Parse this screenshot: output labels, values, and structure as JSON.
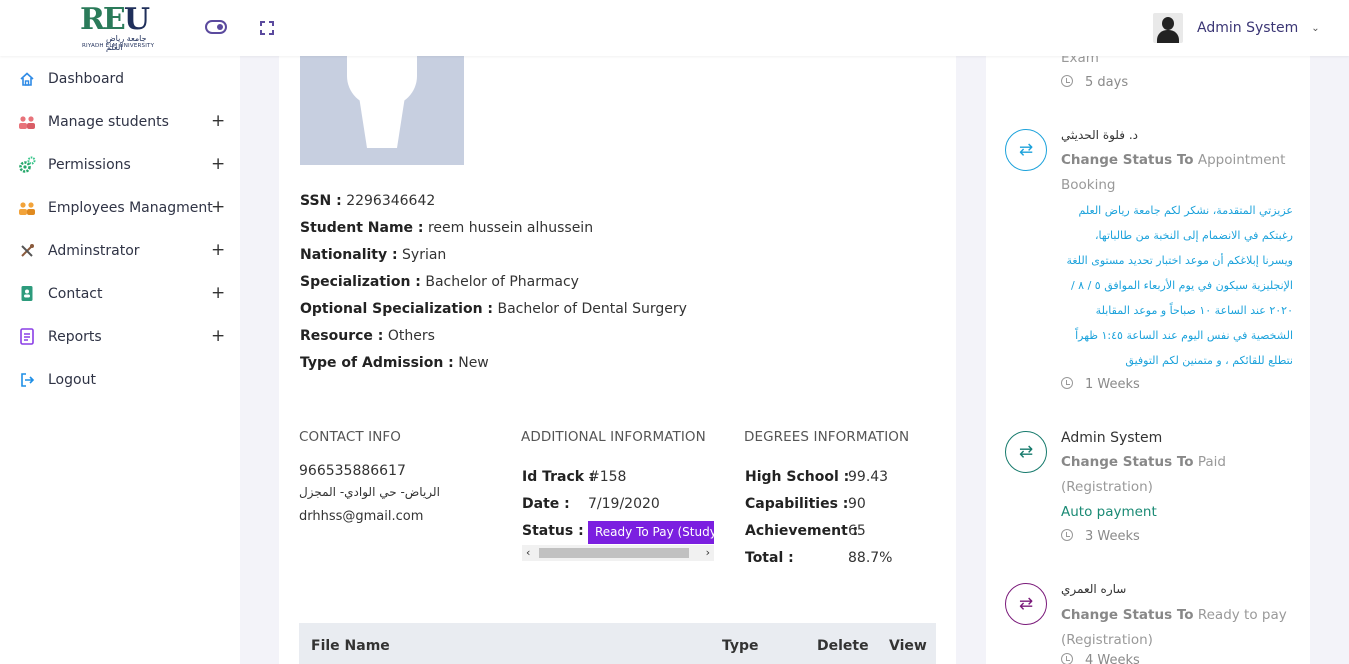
{
  "header": {
    "logo_mark_a": "RE",
    "logo_mark_b": "U",
    "logo_ar": "جامعة رياض العلم",
    "logo_en": "RIYADH ELM UNIVERSITY",
    "user_name": "Admin System",
    "chevron": "⌄"
  },
  "sidebar": {
    "items": [
      {
        "label": "Dashboard",
        "icon": "home-icon"
      },
      {
        "label": "Manage students",
        "icon": "students-icon",
        "expand": "+"
      },
      {
        "label": "Permissions",
        "icon": "gears-icon",
        "expand": "+"
      },
      {
        "label": "Employees Managment",
        "icon": "employees-icon",
        "expand": "+"
      },
      {
        "label": "Adminstrator",
        "icon": "tools-icon",
        "expand": "+"
      },
      {
        "label": "Contact",
        "icon": "contact-book-icon",
        "expand": "+"
      },
      {
        "label": "Reports",
        "icon": "report-icon",
        "expand": "+"
      },
      {
        "label": "Logout",
        "icon": "logout-icon"
      }
    ]
  },
  "student": {
    "ssn_label": "SSN :",
    "ssn": "2296346642",
    "name_label": "Student Name :",
    "name": "reem hussein alhussein",
    "nationality_label": "Nationality :",
    "nationality": "Syrian",
    "specialization_label": "Specialization :",
    "specialization": "Bachelor of Pharmacy",
    "optional_label": "Optional Specialization :",
    "optional": "Bachelor of Dental Surgery",
    "resource_label": "Resource :",
    "resource": "Others",
    "admission_label": "Type of Admission :",
    "admission": "New"
  },
  "contact": {
    "heading": "CONTACT INFO",
    "phone": "966535886617",
    "address": "الرياض- حي الوادي- المجزل",
    "email": "drhhss@gmail.com"
  },
  "additional": {
    "heading": "ADDITIONAL INFORMATION",
    "id_label": "Id Track :",
    "id_value": "#158",
    "date_label": "Date :",
    "date_value": "7/19/2020",
    "status_label": "Status :",
    "status_value": "Ready To Pay (Study)",
    "scroll_left": "‹",
    "scroll_right": "›"
  },
  "degrees": {
    "heading": "DEGREES INFORMATION",
    "high_school_label": "High School :",
    "high_school": "99.43",
    "capabilities_label": "Capabilities :",
    "capabilities": "90",
    "achievement_label": "Achievement :",
    "achievement": "65",
    "total_label": "Total :",
    "total": "88.7%"
  },
  "files_table": {
    "headers": [
      "File Name",
      "Type",
      "Delete",
      "View"
    ]
  },
  "timeline": {
    "top_partial": {
      "text": "Exam",
      "time": "5 days"
    },
    "entries": [
      {
        "author": "د. فلوة الحديثي",
        "change_label": "Change Status To",
        "change_value": "Appointment Booking",
        "message": "عزيزتي المتقدمة، نشكر لكم جامعة رياض العلم رغبتكم في الانضمام إلى النخبة من طالباتها، ويسرنا إبلاغكم أن موعد اختبار تحديد مستوى اللغة الإنجليزية سيكون في يوم الأربعاء الموافق ٥ / ٨ / ٢٠٢٠ عند الساعة ١٠ صباحاً و موعد المقابلة الشخصية في نفس اليوم عند الساعة ١:٤٥ ظهراً نتطلع للقائكم ، و متمنين لكم التوفيق",
        "time": "1 Weeks",
        "icon": "exchange-arrows-icon",
        "color": "#1ca2db"
      },
      {
        "author": "Admin System",
        "change_label": "Change Status To",
        "change_value": "Paid (Registration)",
        "note": "Auto payment",
        "time": "3 Weeks",
        "icon": "exchange-arrows-icon",
        "color": "#167a6c"
      },
      {
        "author": "ساره العمري",
        "change_label": "Change Status To",
        "change_value": "Ready to pay (Registration)",
        "time": "4 Weeks",
        "icon": "exchange-arrows-icon",
        "color": "#7a1a7a"
      }
    ]
  }
}
